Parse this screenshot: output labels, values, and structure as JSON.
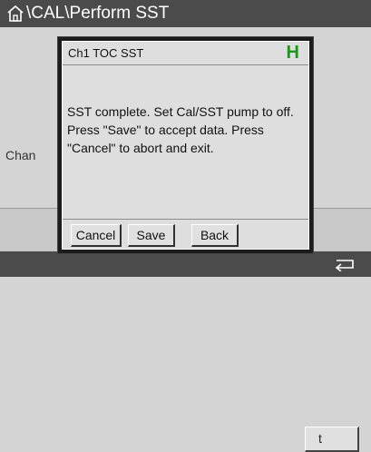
{
  "header": {
    "home_icon": "home-icon",
    "separator": "\\",
    "breadcrumb": [
      "CAL",
      "Perform SST"
    ],
    "background_color": "#4b4b4b"
  },
  "background": {
    "label": "Chan",
    "button_label": "t"
  },
  "footer": {
    "back_icon": "back-arrow-icon"
  },
  "dialog": {
    "title": "Ch1 TOC SST",
    "status_badge": "H",
    "status_badge_color": "#1a9a1a",
    "message": "SST complete. Set Cal/SST pump to off. Press \"Save\" to accept data. Press \"Cancel\" to abort and exit.",
    "buttons": {
      "cancel": "Cancel",
      "save": "Save",
      "back": "Back"
    }
  }
}
